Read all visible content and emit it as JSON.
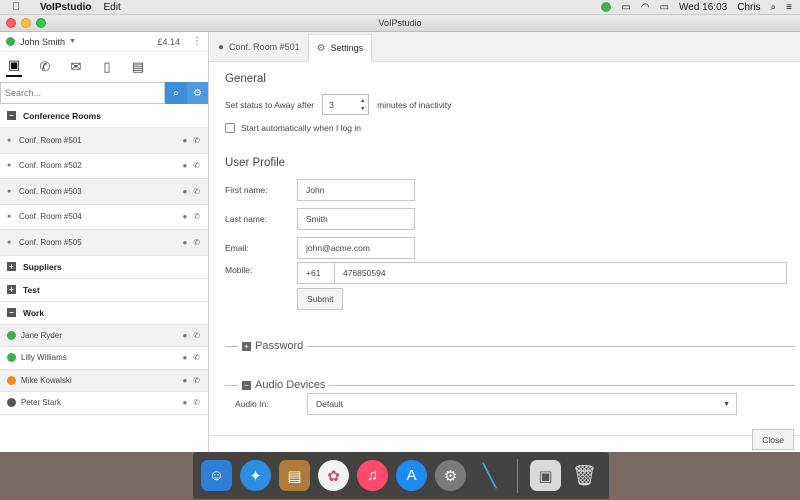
{
  "menubar": {
    "app_name": "VoIPstudio",
    "menu_edit": "Edit",
    "clock": "Wed 16:03",
    "user": "Chris"
  },
  "window": {
    "title": "VoIPstudio"
  },
  "sidebar": {
    "user_name": "John Smith",
    "credit": "£4.14",
    "search_placeholder": "Search...",
    "groups": {
      "conference": {
        "label": "Conference Rooms",
        "items": [
          "Conf. Room #501",
          "Conf. Room #502",
          "Conf. Room #503",
          "Conf. Room #504",
          "Conf. Room #505"
        ]
      },
      "suppliers": {
        "label": "Suppliers"
      },
      "test": {
        "label": "Test"
      },
      "work": {
        "label": "Work",
        "items": [
          {
            "name": "Jane Ryder",
            "status_color": "#3cb04a"
          },
          {
            "name": "Lilly Williams",
            "status_color": "#3cb04a"
          },
          {
            "name": "Mike Kowalski",
            "status_color": "#f08a24"
          },
          {
            "name": "Peter Stark",
            "status_color": "#555555"
          }
        ]
      }
    }
  },
  "tabs": [
    {
      "label": "Conf. Room #501"
    },
    {
      "label": "Settings"
    }
  ],
  "settings": {
    "general_title": "General",
    "away_prefix": "Set status to Away after",
    "away_value": "3",
    "away_suffix": "minutes of inactivity",
    "autostart_label": "Start automatically when I log in",
    "profile_title": "User Profile",
    "first_name_label": "First name:",
    "first_name": "John",
    "last_name_label": "Last name:",
    "last_name": "Smith",
    "email_label": "Email:",
    "email": "john@acme.com",
    "mobile_label": "Mobile:",
    "mobile_prefix": "+61",
    "mobile_number": "476850594",
    "submit_label": "Submit",
    "password_legend": "Password",
    "audio_legend": "Audio Devices",
    "audio_in_label": "Audio In:",
    "audio_in_value": "Default",
    "close_label": "Close"
  },
  "colors": {
    "accent": "#3e8fd6",
    "online": "#3cb04a",
    "away": "#f08a24"
  }
}
